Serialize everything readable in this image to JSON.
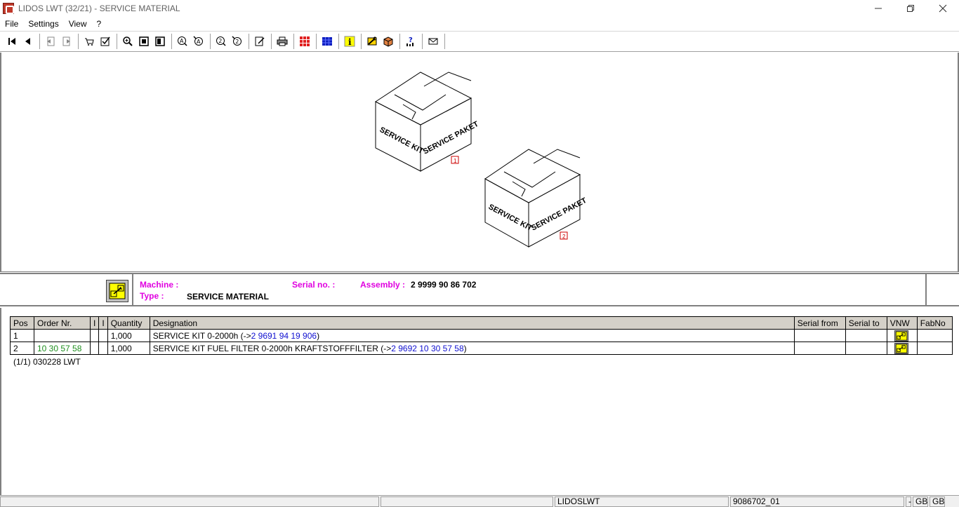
{
  "window": {
    "title": "LIDOS LWT (32/21) - SERVICE MATERIAL"
  },
  "menu": [
    "File",
    "Settings",
    "View",
    "?"
  ],
  "drawing": {
    "boxes": [
      {
        "left_text": "SERVICE KIT",
        "right_text": "SERVICE PAKET",
        "callout": "1"
      },
      {
        "left_text": "SERVICE KIT",
        "right_text": "SERVICE PAKET",
        "callout": "2"
      }
    ]
  },
  "info": {
    "machine_label": "Machine :",
    "machine_value": "",
    "type_label": "Type :",
    "type_value": "SERVICE MATERIAL",
    "serial_label": "Serial no. :",
    "serial_value": "",
    "assembly_label": "Assembly :",
    "assembly_value": "2 9999 90 86 702"
  },
  "table": {
    "headers": {
      "pos": "Pos",
      "order": "Order Nr.",
      "i1": "I",
      "i2": "I",
      "qty": "Quantity",
      "designation": "Designation",
      "serial_from": "Serial from",
      "serial_to": "Serial to",
      "vnw": "VNW",
      "fabno": "FabNo"
    },
    "rows": [
      {
        "pos": "1",
        "order": "",
        "qty": "1,000",
        "designation": "SERVICE KIT 0-2000h (->",
        "link": "2 9691 94 19 906",
        "close": ")"
      },
      {
        "pos": "2",
        "order": "10 30 57 58",
        "qty": "1,000",
        "designation": "SERVICE KIT FUEL FILTER 0-2000h KRAFTSTOFFFILTER (->",
        "link": "2 9692 10 30 57 58",
        "close": ")"
      }
    ],
    "footer": "(1/1) 030228 LWT"
  },
  "status": {
    "app": "LIDOSLWT",
    "doc": "9086702_01",
    "flag": "-",
    "lang1": "GB",
    "lang2": "GB"
  },
  "colors": {
    "label_magenta": "#e000e0",
    "order_green": "#1f8f1f",
    "link_blue": "#1010d0",
    "callout_red": "#cc0000"
  }
}
